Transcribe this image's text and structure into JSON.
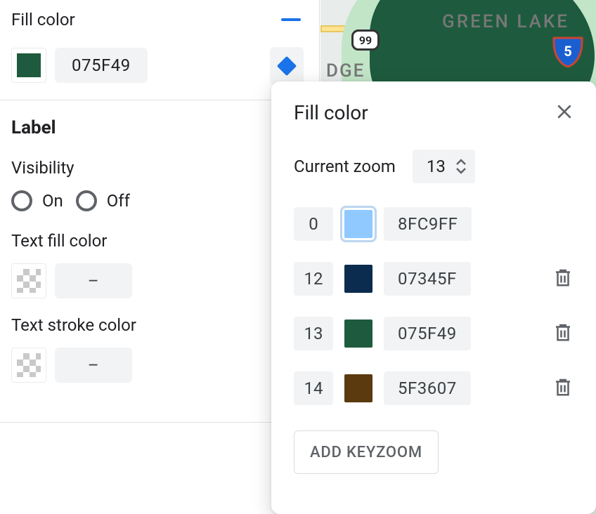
{
  "sidebar": {
    "fill_section_label": "Fill color",
    "fill_hex": "075F49",
    "fill_color": "#1e5b3e",
    "label_heading": "Label",
    "visibility_label": "Visibility",
    "visibility_on": "On",
    "visibility_off": "Off",
    "text_fill_label": "Text fill color",
    "text_fill_value": "–",
    "text_stroke_label": "Text stroke color",
    "text_stroke_value": "–"
  },
  "map": {
    "label_greenlake": "GREEN LAKE",
    "label_dge": "DGE",
    "route99": "99"
  },
  "popup": {
    "title": "Fill color",
    "zoom_label": "Current zoom",
    "zoom_value": "13",
    "keyzooms": [
      {
        "zoom": "0",
        "hex": "8FC9FF",
        "color": "#8fc9ff",
        "selected": true,
        "deletable": false
      },
      {
        "zoom": "12",
        "hex": "07345F",
        "color": "#0b2c4e",
        "selected": false,
        "deletable": true
      },
      {
        "zoom": "13",
        "hex": "075F49",
        "color": "#1e5b3e",
        "selected": false,
        "deletable": true
      },
      {
        "zoom": "14",
        "hex": "5F3607",
        "color": "#5b3a0f",
        "selected": false,
        "deletable": true
      }
    ],
    "add_button": "ADD KEYZOOM"
  }
}
